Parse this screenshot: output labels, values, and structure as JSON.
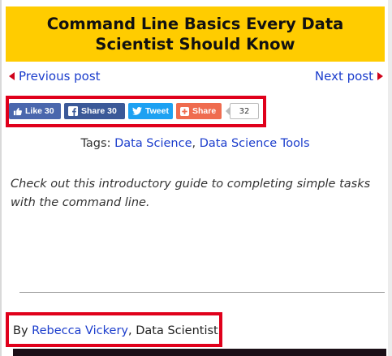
{
  "post": {
    "title": "Command Line Basics Every Data Scientist Should Know",
    "intro": "Check out this introductory guide to completing simple tasks with the command line."
  },
  "nav": {
    "previous_label": "Previous post",
    "next_label": "Next post"
  },
  "share": {
    "like_label": "Like 30",
    "share_label": "Share 30",
    "tweet_label": "Tweet",
    "plus_share_label": "Share",
    "count": "32"
  },
  "tags": {
    "prefix": "Tags:",
    "items": [
      "Data Science",
      "Data Science Tools"
    ],
    "separator": ","
  },
  "author": {
    "prefix": "By",
    "name": "Rebecca Vickery",
    "separator": ",",
    "role": "Data Scientist"
  },
  "colors": {
    "title_banner": "#ffcc00",
    "link": "#1a3ccc",
    "highlight_box": "#e0001b",
    "nav_arrow": "#d0021b",
    "facebook": "#3b5998",
    "twitter": "#1da1f2",
    "share_plus": "#ef6c4f"
  },
  "icons": [
    "thumbs-up-icon",
    "facebook-icon",
    "twitter-bird-icon",
    "plus-icon",
    "caret-left-icon",
    "caret-right-icon"
  ]
}
